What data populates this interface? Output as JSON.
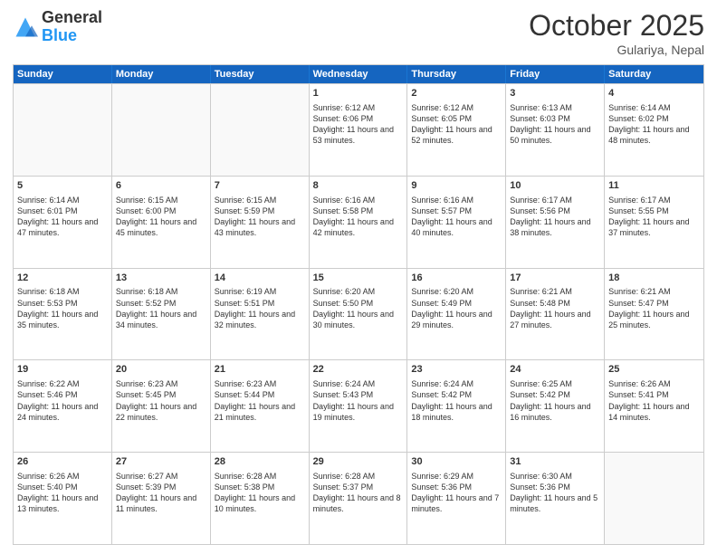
{
  "header": {
    "logo": {
      "general": "General",
      "blue": "Blue"
    },
    "month": "October 2025",
    "location": "Gulariya, Nepal"
  },
  "days": [
    "Sunday",
    "Monday",
    "Tuesday",
    "Wednesday",
    "Thursday",
    "Friday",
    "Saturday"
  ],
  "weeks": [
    [
      {
        "day": "",
        "sunrise": "",
        "sunset": "",
        "daylight": ""
      },
      {
        "day": "",
        "sunrise": "",
        "sunset": "",
        "daylight": ""
      },
      {
        "day": "",
        "sunrise": "",
        "sunset": "",
        "daylight": ""
      },
      {
        "day": "1",
        "sunrise": "Sunrise: 6:12 AM",
        "sunset": "Sunset: 6:06 PM",
        "daylight": "Daylight: 11 hours and 53 minutes."
      },
      {
        "day": "2",
        "sunrise": "Sunrise: 6:12 AM",
        "sunset": "Sunset: 6:05 PM",
        "daylight": "Daylight: 11 hours and 52 minutes."
      },
      {
        "day": "3",
        "sunrise": "Sunrise: 6:13 AM",
        "sunset": "Sunset: 6:03 PM",
        "daylight": "Daylight: 11 hours and 50 minutes."
      },
      {
        "day": "4",
        "sunrise": "Sunrise: 6:14 AM",
        "sunset": "Sunset: 6:02 PM",
        "daylight": "Daylight: 11 hours and 48 minutes."
      }
    ],
    [
      {
        "day": "5",
        "sunrise": "Sunrise: 6:14 AM",
        "sunset": "Sunset: 6:01 PM",
        "daylight": "Daylight: 11 hours and 47 minutes."
      },
      {
        "day": "6",
        "sunrise": "Sunrise: 6:15 AM",
        "sunset": "Sunset: 6:00 PM",
        "daylight": "Daylight: 11 hours and 45 minutes."
      },
      {
        "day": "7",
        "sunrise": "Sunrise: 6:15 AM",
        "sunset": "Sunset: 5:59 PM",
        "daylight": "Daylight: 11 hours and 43 minutes."
      },
      {
        "day": "8",
        "sunrise": "Sunrise: 6:16 AM",
        "sunset": "Sunset: 5:58 PM",
        "daylight": "Daylight: 11 hours and 42 minutes."
      },
      {
        "day": "9",
        "sunrise": "Sunrise: 6:16 AM",
        "sunset": "Sunset: 5:57 PM",
        "daylight": "Daylight: 11 hours and 40 minutes."
      },
      {
        "day": "10",
        "sunrise": "Sunrise: 6:17 AM",
        "sunset": "Sunset: 5:56 PM",
        "daylight": "Daylight: 11 hours and 38 minutes."
      },
      {
        "day": "11",
        "sunrise": "Sunrise: 6:17 AM",
        "sunset": "Sunset: 5:55 PM",
        "daylight": "Daylight: 11 hours and 37 minutes."
      }
    ],
    [
      {
        "day": "12",
        "sunrise": "Sunrise: 6:18 AM",
        "sunset": "Sunset: 5:53 PM",
        "daylight": "Daylight: 11 hours and 35 minutes."
      },
      {
        "day": "13",
        "sunrise": "Sunrise: 6:18 AM",
        "sunset": "Sunset: 5:52 PM",
        "daylight": "Daylight: 11 hours and 34 minutes."
      },
      {
        "day": "14",
        "sunrise": "Sunrise: 6:19 AM",
        "sunset": "Sunset: 5:51 PM",
        "daylight": "Daylight: 11 hours and 32 minutes."
      },
      {
        "day": "15",
        "sunrise": "Sunrise: 6:20 AM",
        "sunset": "Sunset: 5:50 PM",
        "daylight": "Daylight: 11 hours and 30 minutes."
      },
      {
        "day": "16",
        "sunrise": "Sunrise: 6:20 AM",
        "sunset": "Sunset: 5:49 PM",
        "daylight": "Daylight: 11 hours and 29 minutes."
      },
      {
        "day": "17",
        "sunrise": "Sunrise: 6:21 AM",
        "sunset": "Sunset: 5:48 PM",
        "daylight": "Daylight: 11 hours and 27 minutes."
      },
      {
        "day": "18",
        "sunrise": "Sunrise: 6:21 AM",
        "sunset": "Sunset: 5:47 PM",
        "daylight": "Daylight: 11 hours and 25 minutes."
      }
    ],
    [
      {
        "day": "19",
        "sunrise": "Sunrise: 6:22 AM",
        "sunset": "Sunset: 5:46 PM",
        "daylight": "Daylight: 11 hours and 24 minutes."
      },
      {
        "day": "20",
        "sunrise": "Sunrise: 6:23 AM",
        "sunset": "Sunset: 5:45 PM",
        "daylight": "Daylight: 11 hours and 22 minutes."
      },
      {
        "day": "21",
        "sunrise": "Sunrise: 6:23 AM",
        "sunset": "Sunset: 5:44 PM",
        "daylight": "Daylight: 11 hours and 21 minutes."
      },
      {
        "day": "22",
        "sunrise": "Sunrise: 6:24 AM",
        "sunset": "Sunset: 5:43 PM",
        "daylight": "Daylight: 11 hours and 19 minutes."
      },
      {
        "day": "23",
        "sunrise": "Sunrise: 6:24 AM",
        "sunset": "Sunset: 5:42 PM",
        "daylight": "Daylight: 11 hours and 18 minutes."
      },
      {
        "day": "24",
        "sunrise": "Sunrise: 6:25 AM",
        "sunset": "Sunset: 5:42 PM",
        "daylight": "Daylight: 11 hours and 16 minutes."
      },
      {
        "day": "25",
        "sunrise": "Sunrise: 6:26 AM",
        "sunset": "Sunset: 5:41 PM",
        "daylight": "Daylight: 11 hours and 14 minutes."
      }
    ],
    [
      {
        "day": "26",
        "sunrise": "Sunrise: 6:26 AM",
        "sunset": "Sunset: 5:40 PM",
        "daylight": "Daylight: 11 hours and 13 minutes."
      },
      {
        "day": "27",
        "sunrise": "Sunrise: 6:27 AM",
        "sunset": "Sunset: 5:39 PM",
        "daylight": "Daylight: 11 hours and 11 minutes."
      },
      {
        "day": "28",
        "sunrise": "Sunrise: 6:28 AM",
        "sunset": "Sunset: 5:38 PM",
        "daylight": "Daylight: 11 hours and 10 minutes."
      },
      {
        "day": "29",
        "sunrise": "Sunrise: 6:28 AM",
        "sunset": "Sunset: 5:37 PM",
        "daylight": "Daylight: 11 hours and 8 minutes."
      },
      {
        "day": "30",
        "sunrise": "Sunrise: 6:29 AM",
        "sunset": "Sunset: 5:36 PM",
        "daylight": "Daylight: 11 hours and 7 minutes."
      },
      {
        "day": "31",
        "sunrise": "Sunrise: 6:30 AM",
        "sunset": "Sunset: 5:36 PM",
        "daylight": "Daylight: 11 hours and 5 minutes."
      },
      {
        "day": "",
        "sunrise": "",
        "sunset": "",
        "daylight": ""
      }
    ]
  ]
}
